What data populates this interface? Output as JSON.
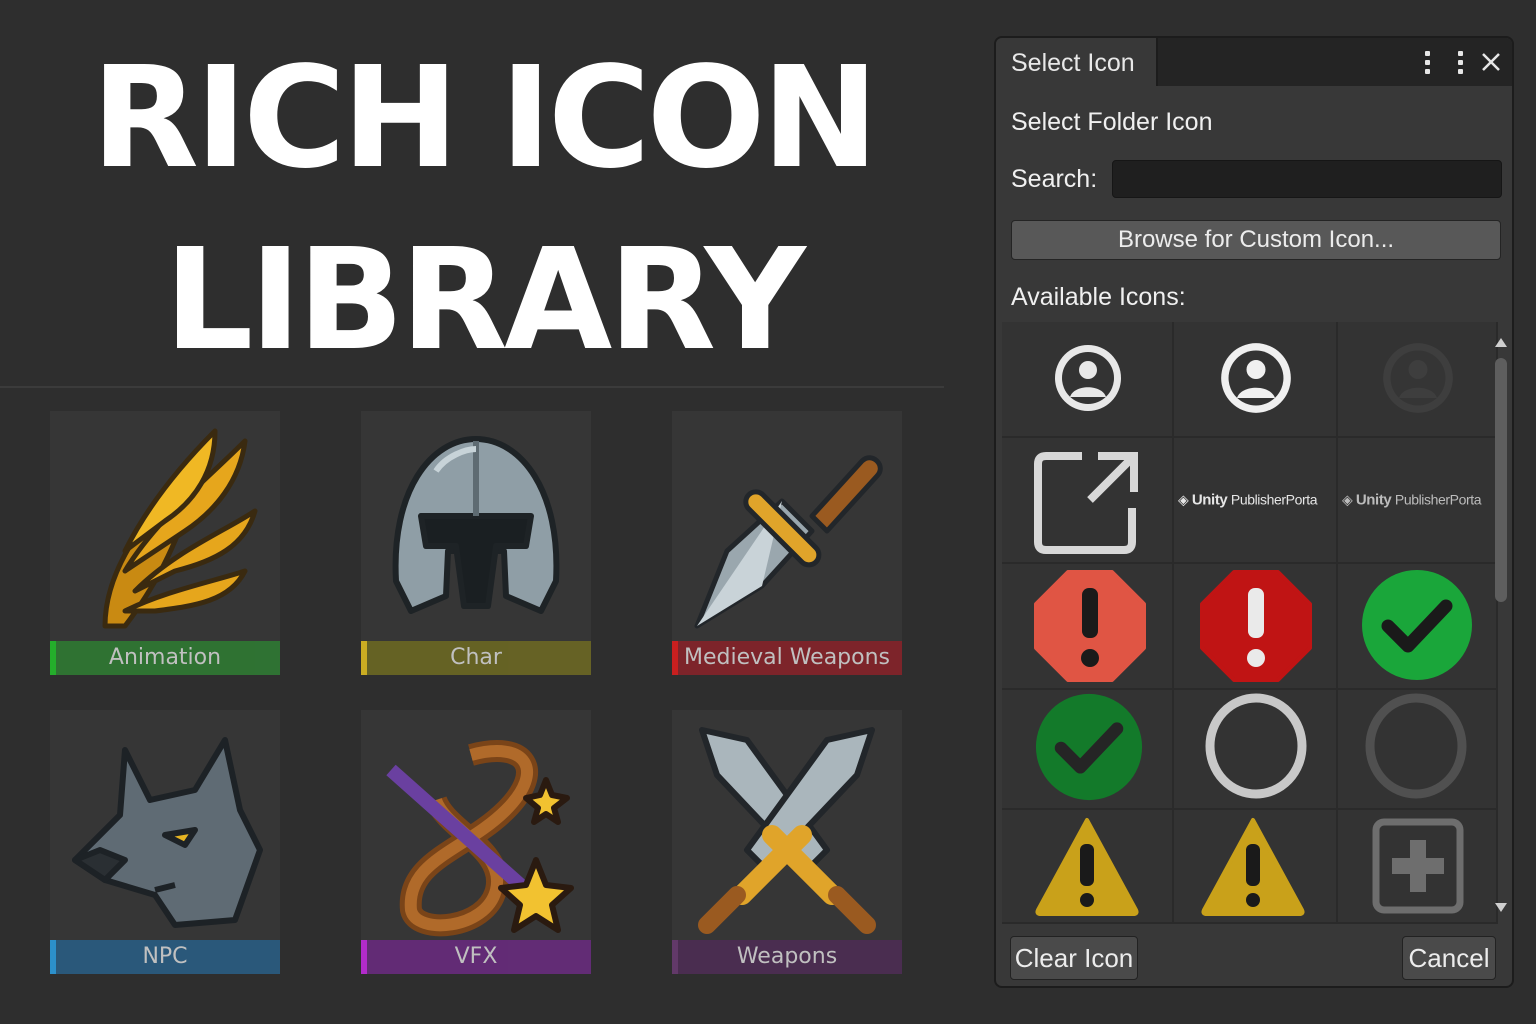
{
  "headline": {
    "line1": "RICH ICON",
    "line2": "LIBRARY"
  },
  "folders": [
    {
      "label": "Animation",
      "color": "#2e7d32",
      "bar": "#22c42a",
      "icon": "wing-icon"
    },
    {
      "label": "Char",
      "color": "#6e6a22",
      "bar": "#e6c21f",
      "icon": "helmet-icon"
    },
    {
      "label": "Medieval Weapons",
      "color": "#8a2128",
      "bar": "#e21b1b",
      "icon": "dagger-icon"
    },
    {
      "label": "NPC",
      "color": "#285e86",
      "bar": "#2ba0e6",
      "icon": "wolf-icon"
    },
    {
      "label": "VFX",
      "color": "#6a2a80",
      "bar": "#c82ae6",
      "icon": "magic-wand-icon"
    },
    {
      "label": "Weapons",
      "color": "#4e2c55",
      "bar": "#6a3a72",
      "icon": "crossed-swords-icon"
    }
  ],
  "window": {
    "tab_title": "Select Icon",
    "menu_icon": "kebab-menu-icon",
    "close_icon": "close-icon",
    "folder_title": "Select Folder Icon",
    "search_label": "Search:",
    "search_value": "",
    "browse_label": "Browse for Custom Icon...",
    "available_label": "Available Icons:",
    "unity_text_bold": "Unity",
    "unity_text": "PublisherPorta",
    "clear_label": "Clear Icon",
    "cancel_label": "Cancel"
  },
  "available_icons": [
    "user-avatar-icon",
    "user-avatar-icon",
    "user-avatar-dim-icon",
    "external-link-icon",
    "unity-publisher-portal-logo",
    "unity-publisher-portal-logo-dim",
    "error-octagon-icon",
    "error-octagon-dark-icon",
    "check-circle-icon",
    "check-circle-dark-icon",
    "circle-outline-icon",
    "circle-outline-dim-icon",
    "warning-triangle-icon",
    "warning-triangle-icon",
    "add-box-icon"
  ]
}
